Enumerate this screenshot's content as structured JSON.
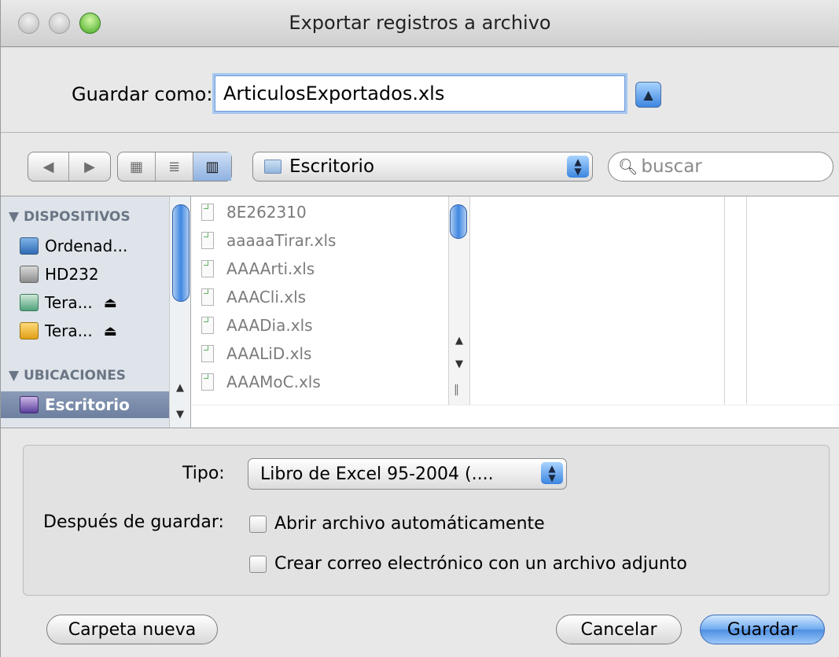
{
  "window": {
    "title": "Exportar registros a archivo"
  },
  "save_as": {
    "label": "Guardar como:",
    "value": "ArticulosExportados.xls"
  },
  "toolbar": {
    "back_icon": "◀",
    "forward_icon": "▶",
    "view_icons": [
      "▦",
      "≣",
      "▥"
    ],
    "location": "Escritorio",
    "search_placeholder": "buscar"
  },
  "sidebar": {
    "sections": [
      {
        "heading": "▼ DISPOSITIVOS",
        "items": [
          {
            "label": "Ordenad...",
            "icon": "computer-icon"
          },
          {
            "label": "HD232",
            "icon": "hard-disk-icon"
          },
          {
            "label": "Tera...",
            "icon": "time-machine-disk-icon",
            "eject": "⏏"
          },
          {
            "label": "Tera...",
            "icon": "external-disk-icon",
            "eject": "⏏"
          }
        ]
      },
      {
        "heading": "▼ UBICACIONES",
        "items": [
          {
            "label": "Escritorio",
            "icon": "desktop-icon",
            "selected": true
          }
        ]
      }
    ]
  },
  "files": [
    "8E262310",
    "aaaaaTirar.xls",
    "AAAArti.xls",
    "AAACli.xls",
    "AAADia.xls",
    "AAALiD.xls",
    "AAAMoC.xls"
  ],
  "options": {
    "type_label": "Tipo:",
    "type_value": "Libro de Excel 95-2004 (....",
    "after_save_label": "Después de guardar:",
    "checkboxes": [
      {
        "label": "Abrir archivo automáticamente",
        "checked": false
      },
      {
        "label": "Crear correo electrónico con un archivo adjunto",
        "checked": false
      }
    ]
  },
  "buttons": {
    "new_folder": "Carpeta nueva",
    "cancel": "Cancelar",
    "save": "Guardar"
  }
}
